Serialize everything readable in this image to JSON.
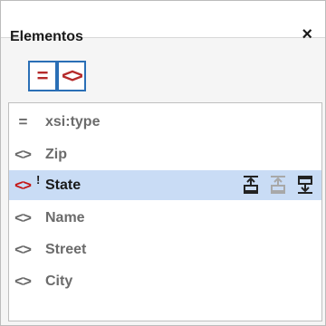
{
  "panel": {
    "title": "Elementos",
    "close_glyph": "×"
  },
  "toolbar": {
    "buttons": [
      {
        "name": "attributes-toggle",
        "glyph": "=",
        "icon": "equals-icon"
      },
      {
        "name": "elements-toggle",
        "glyph": "<>",
        "icon": "element-tag-icon"
      }
    ]
  },
  "list": {
    "items": [
      {
        "label": "xsi:type",
        "icon": "attribute-equals-icon",
        "glyph": "=",
        "selected": false
      },
      {
        "label": "Zip",
        "icon": "element-tag-icon",
        "glyph": "<>",
        "selected": false
      },
      {
        "label": "State",
        "icon": "element-tag-icon",
        "glyph": "<>",
        "selected": true,
        "required_marker": "!"
      },
      {
        "label": "Name",
        "icon": "element-tag-icon",
        "glyph": "<>",
        "selected": false
      },
      {
        "label": "Street",
        "icon": "element-tag-icon",
        "glyph": "<>",
        "selected": false
      },
      {
        "label": "City",
        "icon": "element-tag-icon",
        "glyph": "<>",
        "selected": false
      }
    ],
    "selected_actions": [
      {
        "name": "insert-before",
        "icon": "insert-before-icon",
        "enabled": true
      },
      {
        "name": "append-child",
        "icon": "append-icon",
        "enabled": false
      },
      {
        "name": "insert-after",
        "icon": "insert-after-icon",
        "enabled": true
      }
    ]
  },
  "colors": {
    "accent": "#2a6fb6",
    "selection": "#c9dcf5",
    "icon_red": "#c41616",
    "muted_text": "#6b6b6b"
  }
}
